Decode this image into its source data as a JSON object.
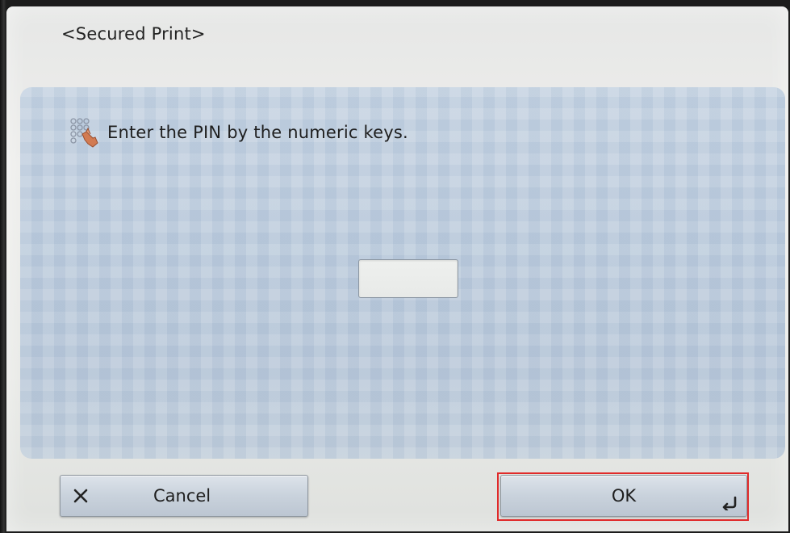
{
  "window": {
    "title": "<Secured Print>"
  },
  "prompt": {
    "icon": "numeric-keypad-icon",
    "text": "Enter the PIN by the numeric keys."
  },
  "pin_field": {
    "value": ""
  },
  "buttons": {
    "cancel_label": "Cancel",
    "cancel_icon": "close-x-icon",
    "ok_label": "OK",
    "ok_icon": "enter-return-icon"
  },
  "colors": {
    "panel": "#bccbdc",
    "highlight": "#e02a2a",
    "button": "#c9d2dc"
  }
}
